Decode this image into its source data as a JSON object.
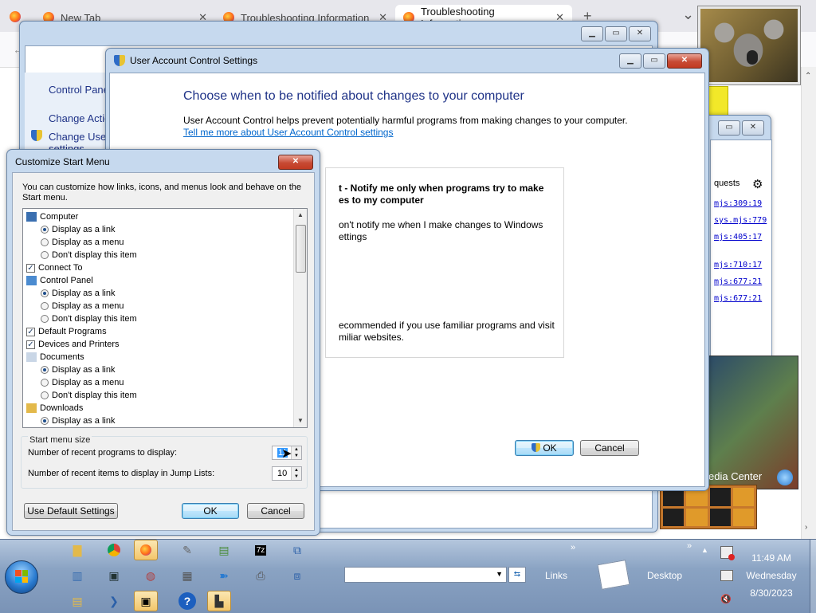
{
  "browser": {
    "tabs": [
      {
        "label": "New Tab"
      },
      {
        "label": "Troubleshooting Information"
      },
      {
        "label": "Troubleshooting Information"
      }
    ],
    "new_tab_glyph": "+",
    "close_glyph": "✕",
    "tab_list_glyph": "⌄"
  },
  "control_panel": {
    "links": [
      "Control Panel",
      "Change Actio",
      "Change User",
      "settings"
    ]
  },
  "uac": {
    "title": "User Account Control Settings",
    "heading": "Choose when to be notified about changes to your computer",
    "description": "User Account Control helps prevent potentially harmful programs from making changes to your computer.",
    "learn_more_link": "Tell me more about User Account Control settings",
    "level_title": "t - Notify me only when programs try to make\nes to my computer",
    "level_desc": "on't notify me when I make changes to Windows\nettings",
    "recommendation": "ecommended if you use familiar programs and visit\nmiliar websites.",
    "ok_label": "OK",
    "cancel_label": "Cancel"
  },
  "right_panel": {
    "header": "quests",
    "links": [
      "mjs:309:19",
      "sys.mjs:779",
      "mjs:405:17",
      "mjs:710:17",
      "mjs:677:21",
      "mjs:677:21"
    ],
    "media_center_label": "edia Center"
  },
  "customize_start_menu": {
    "title": "Customize Start Menu",
    "intro": "You can customize how links, icons, and menus look and behave on the Start menu.",
    "items": [
      {
        "type": "header",
        "icon": "computer-icon",
        "label": "Computer"
      },
      {
        "type": "radio",
        "checked": true,
        "label": "Display as a link"
      },
      {
        "type": "radio",
        "checked": false,
        "label": "Display as a menu"
      },
      {
        "type": "radio",
        "checked": false,
        "label": "Don't display this item"
      },
      {
        "type": "check",
        "checked": true,
        "label": "Connect To"
      },
      {
        "type": "header",
        "icon": "control-panel-icon",
        "label": "Control Panel"
      },
      {
        "type": "radio",
        "checked": true,
        "label": "Display as a link"
      },
      {
        "type": "radio",
        "checked": false,
        "label": "Display as a menu"
      },
      {
        "type": "radio",
        "checked": false,
        "label": "Don't display this item"
      },
      {
        "type": "check",
        "checked": true,
        "label": "Default Programs"
      },
      {
        "type": "check",
        "checked": true,
        "label": "Devices and Printers"
      },
      {
        "type": "header",
        "icon": "documents-icon",
        "label": "Documents"
      },
      {
        "type": "radio",
        "checked": true,
        "label": "Display as a link"
      },
      {
        "type": "radio",
        "checked": false,
        "label": "Display as a menu"
      },
      {
        "type": "radio",
        "checked": false,
        "label": "Don't display this item"
      },
      {
        "type": "header",
        "icon": "downloads-icon",
        "label": "Downloads"
      },
      {
        "type": "radio",
        "checked": true,
        "label": "Display as a link"
      }
    ],
    "size_group_title": "Start menu size",
    "recent_programs_label": "Number of recent programs to display:",
    "recent_programs_value": "11",
    "recent_items_label": "Number of recent items to display in Jump Lists:",
    "recent_items_value": "10",
    "use_default_label": "Use Default Settings",
    "ok_label": "OK",
    "cancel_label": "Cancel"
  },
  "taskbar": {
    "links_label": "Links",
    "desktop_label": "Desktop",
    "time": "11:49 AM",
    "day": "Wednesday",
    "date": "8/30/2023",
    "expand_glyph": "»",
    "seven_zip": "7z"
  }
}
